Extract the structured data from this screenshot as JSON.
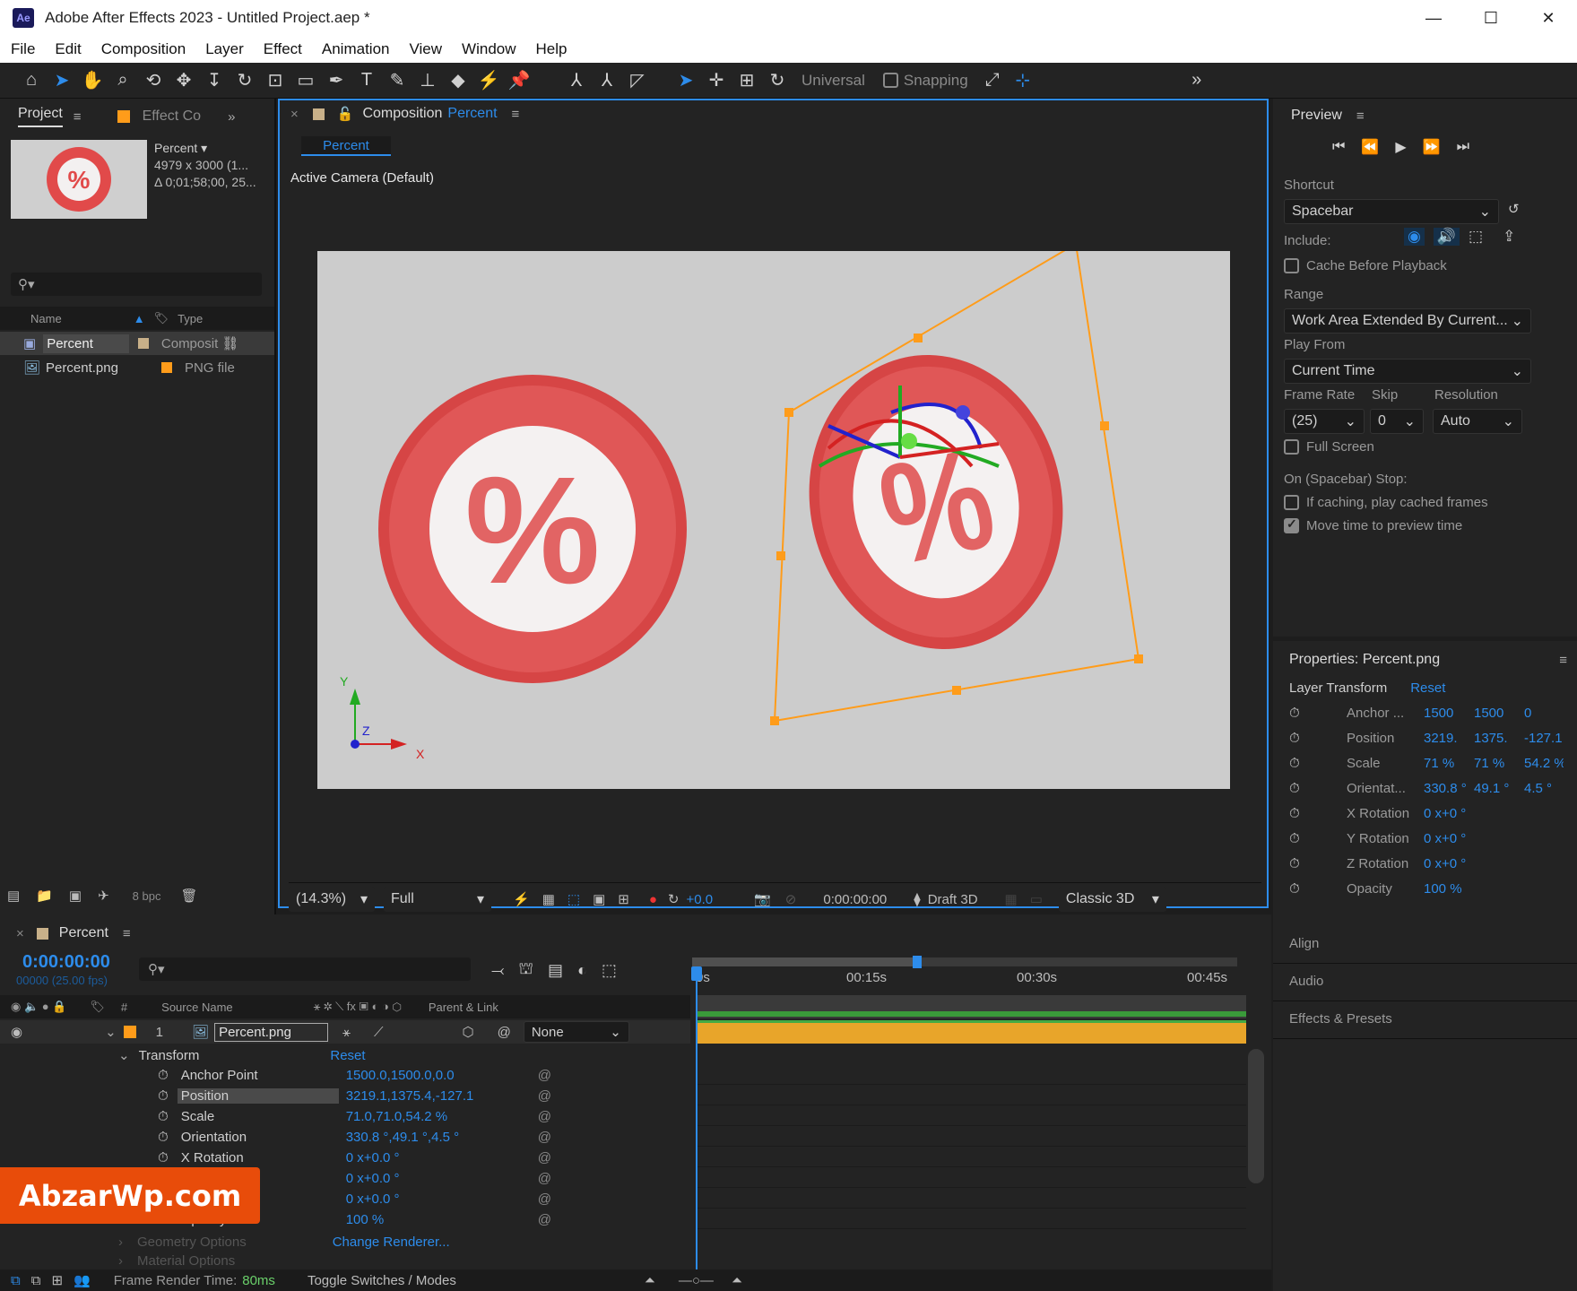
{
  "window": {
    "title": "Adobe After Effects 2023 - Untitled Project.aep *",
    "logo": "Ae",
    "minimize": "—",
    "maximize": "☐",
    "close": "✕"
  },
  "menu": [
    "File",
    "Edit",
    "Composition",
    "Layer",
    "Effect",
    "Animation",
    "View",
    "Window",
    "Help"
  ],
  "toolbar": {
    "axis_mode": "Universal",
    "snapping": "Snapping",
    "expand": "»"
  },
  "project": {
    "tab": "Project",
    "tab2": "Effect Co",
    "thumb_name": "Percent",
    "thumb_dims": "4979 x 3000 (1...",
    "thumb_dur": "Δ 0;01;58;00, 25...",
    "search_placeholder": "",
    "columns": {
      "name": "Name",
      "type": "Type"
    },
    "items": [
      {
        "name": "Percent",
        "type": "Composit"
      },
      {
        "name": "Percent.png",
        "type": "PNG file"
      }
    ],
    "bpc": "8 bpc"
  },
  "composition": {
    "close": "×",
    "tab_prefix": "Composition",
    "tab_name": "Percent",
    "subtab": "Percent",
    "camera": "Active Camera (Default)",
    "axis": {
      "x": "X",
      "y": "Y",
      "z": "Z"
    },
    "footer": {
      "zoom": "(14.3%)",
      "resolution": "Full",
      "exposure": "+0.0",
      "timecode": "0:00:00:00",
      "draft": "Draft 3D",
      "renderer": "Classic 3D"
    }
  },
  "preview": {
    "title": "Preview",
    "shortcut_label": "Shortcut",
    "shortcut": "Spacebar",
    "include_label": "Include:",
    "cache": "Cache Before Playback",
    "range_label": "Range",
    "range": "Work Area Extended By Current...",
    "playfrom_label": "Play From",
    "playfrom": "Current Time",
    "fr_label": "Frame Rate",
    "skip_label": "Skip",
    "res_label": "Resolution",
    "fr": "(25)",
    "skip": "0",
    "res": "Auto",
    "fullscreen": "Full Screen",
    "stop_label": "On (Spacebar) Stop:",
    "stop1": "If caching, play cached frames",
    "stop2": "Move time to preview time"
  },
  "properties": {
    "title": "Properties: Percent.png",
    "section": "Layer Transform",
    "reset": "Reset",
    "rows": [
      {
        "name": "Anchor ...",
        "v1": "1500",
        "v2": "1500",
        "v3": "0"
      },
      {
        "name": "Position",
        "v1": "3219.",
        "v2": "1375.",
        "v3": "-127.1"
      },
      {
        "name": "Scale",
        "v1": "71 %",
        "v2": "71 %",
        "v3": "54.2 %"
      },
      {
        "name": "Orientat...",
        "v1": "330.8 °",
        "v2": "49.1 °",
        "v3": "4.5 °"
      },
      {
        "name": "X Rotation",
        "v1": "0 x+0 °",
        "v2": "",
        "v3": ""
      },
      {
        "name": "Y Rotation",
        "v1": "0 x+0 °",
        "v2": "",
        "v3": ""
      },
      {
        "name": "Z Rotation",
        "v1": "0 x+0 °",
        "v2": "",
        "v3": ""
      },
      {
        "name": "Opacity",
        "v1": "100 %",
        "v2": "",
        "v3": ""
      }
    ]
  },
  "side_panels": [
    "Align",
    "Audio",
    "Effects & Presets"
  ],
  "timeline": {
    "tab": "Percent",
    "timecode": "0:00:00:00",
    "fps": "00000 (25.00 fps)",
    "ruler": [
      "0s",
      "00:15s",
      "00:30s",
      "00:45s"
    ],
    "col_source": "Source Name",
    "col_parent": "Parent & Link",
    "layer": {
      "num": "1",
      "name": "Percent.png",
      "parent": "None"
    },
    "transform": "Transform",
    "reset": "Reset",
    "props": [
      {
        "name": "Anchor Point",
        "value": "1500.0,1500.0,0.0"
      },
      {
        "name": "Position",
        "value": "3219.1,1375.4,-127.1"
      },
      {
        "name": "Scale",
        "value": "71.0,71.0,54.2 %"
      },
      {
        "name": "Orientation",
        "value": "330.8 °,49.1 °,4.5 °"
      },
      {
        "name": "X Rotation",
        "value": "0 x+0.0 °"
      },
      {
        "name": "Y Rotation",
        "value": "0 x+0.0 °"
      },
      {
        "name": "Z Rotation",
        "value": "0 x+0.0 °"
      },
      {
        "name": "Opacity",
        "value": "100 %"
      }
    ],
    "geom": "Geometry Options",
    "geom_value": "Change Renderer...",
    "material": "Material Options",
    "render_label": "Frame Render Time:",
    "render_value": "80ms",
    "toggle": "Toggle Switches / Modes"
  },
  "watermark": "AbzarWp.com",
  "colors": {
    "accent": "#2d8ceb",
    "selection": "#ff9c1a",
    "layer_bar": "#e8a52a"
  }
}
